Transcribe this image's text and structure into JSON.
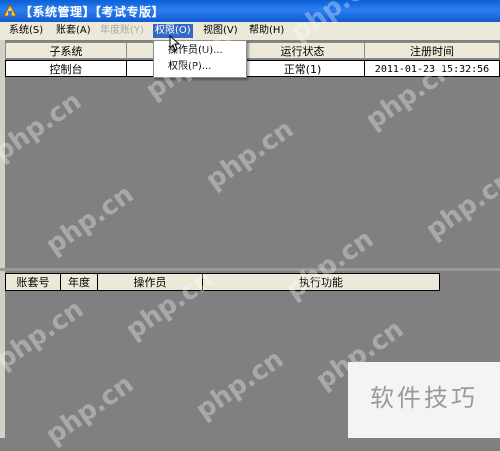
{
  "window": {
    "title": "【系统管理】【考试专版】"
  },
  "menu": [
    {
      "label": "系统(S)",
      "state": "normal"
    },
    {
      "label": "账套(A)",
      "state": "normal"
    },
    {
      "label": "年度账(Y)",
      "state": "disabled"
    },
    {
      "label": "权限(O)",
      "state": "active"
    },
    {
      "label": "视图(V)",
      "state": "normal"
    },
    {
      "label": "帮助(H)",
      "state": "normal"
    }
  ],
  "permissions_menu": {
    "items": [
      "操作员(U)...",
      "权限(P)..."
    ]
  },
  "subsystem_table": {
    "columns": [
      "子系统",
      "",
      "运行状态",
      "注册时间"
    ],
    "rows": [
      [
        "控制台",
        "",
        "正常(1)",
        "2011-01-23 15:32:56"
      ]
    ]
  },
  "task_table": {
    "columns": [
      "账套号",
      "年度",
      "操作员",
      "执行功能"
    ]
  },
  "watermark": "php.cn",
  "badge": "软件技巧",
  "colors": {
    "titlebar": "#1259d0",
    "menubar": "#ece9d8",
    "workspace": "#808080",
    "highlight": "#316ac5"
  }
}
